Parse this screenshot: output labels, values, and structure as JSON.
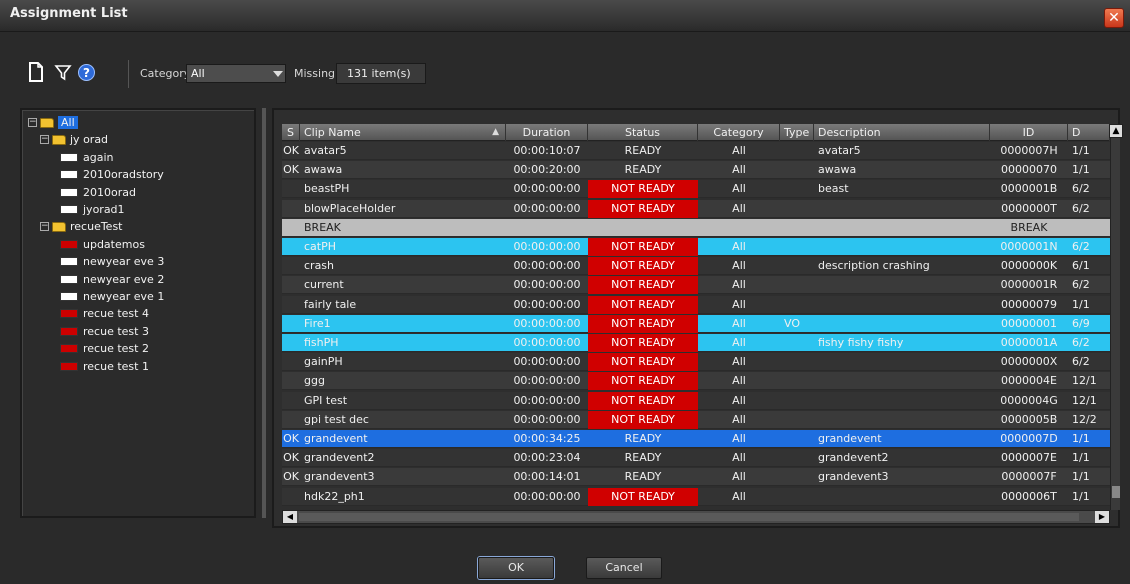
{
  "window": {
    "title": "Assignment List",
    "close_glyph": "✕"
  },
  "toolbar": {
    "category_label": "Category:",
    "category_value": "All",
    "missing_label": "Missing:",
    "missing_value": "131 item(s)",
    "help_glyph": "?"
  },
  "tree": [
    {
      "label": "All",
      "kind": "folder",
      "level": 0,
      "expander": "−",
      "selected": true
    },
    {
      "label": "jy orad",
      "kind": "folder",
      "level": 1,
      "expander": "−"
    },
    {
      "label": "again",
      "kind": "white",
      "level": 2
    },
    {
      "label": "2010oradstory",
      "kind": "white",
      "level": 2
    },
    {
      "label": "2010orad",
      "kind": "white",
      "level": 2
    },
    {
      "label": "jyorad1",
      "kind": "white",
      "level": 2
    },
    {
      "label": "recueTest",
      "kind": "folder",
      "level": 1,
      "expander": "−"
    },
    {
      "label": "updatemos",
      "kind": "red",
      "level": 2
    },
    {
      "label": "newyear eve 3",
      "kind": "white",
      "level": 2
    },
    {
      "label": "newyear eve 2",
      "kind": "white",
      "level": 2
    },
    {
      "label": "newyear eve 1",
      "kind": "white",
      "level": 2
    },
    {
      "label": "recue test 4",
      "kind": "red",
      "level": 2
    },
    {
      "label": "recue test 3",
      "kind": "red",
      "level": 2
    },
    {
      "label": "recue test 2",
      "kind": "red",
      "level": 2
    },
    {
      "label": "recue test 1",
      "kind": "red",
      "level": 2
    }
  ],
  "grid": {
    "columns": [
      "S",
      "Clip Name",
      "Duration",
      "Status",
      "Category",
      "Type",
      "Description",
      "ID",
      "D"
    ],
    "sort_glyph": "▲",
    "rows": [
      {
        "s": "OK",
        "clip": "avatar5",
        "duration": "00:00:10:07",
        "status": "READY",
        "category": "All",
        "type": "",
        "description": "avatar5",
        "id": "0000007H",
        "date": "1/1",
        "style": ""
      },
      {
        "s": "OK",
        "clip": "awawa",
        "duration": "00:00:20:00",
        "status": "READY",
        "category": "All",
        "type": "",
        "description": "awawa",
        "id": "00000070",
        "date": "1/1",
        "style": "alt"
      },
      {
        "s": "",
        "clip": "beastPH",
        "duration": "00:00:00:00",
        "status": "NOT READY",
        "category": "All",
        "type": "",
        "description": "beast",
        "id": "0000001B",
        "date": "6/2",
        "style": ""
      },
      {
        "s": "",
        "clip": "blowPlaceHolder",
        "duration": "00:00:00:00",
        "status": "NOT READY",
        "category": "All",
        "type": "",
        "description": "",
        "id": "0000000T",
        "date": "6/2",
        "style": "alt"
      },
      {
        "s": "",
        "clip": "BREAK",
        "duration": "",
        "status": "",
        "category": "",
        "type": "",
        "description": "",
        "id": "BREAK",
        "date": "",
        "style": "brk"
      },
      {
        "s": "",
        "clip": "catPH",
        "duration": "00:00:00:00",
        "status": "NOT READY",
        "category": "All",
        "type": "",
        "description": "",
        "id": "0000001N",
        "date": "6/2",
        "style": "cyan"
      },
      {
        "s": "",
        "clip": "crash",
        "duration": "00:00:00:00",
        "status": "NOT READY",
        "category": "All",
        "type": "",
        "description": "description crashing",
        "id": "0000000K",
        "date": "6/1",
        "style": ""
      },
      {
        "s": "",
        "clip": "current",
        "duration": "00:00:00:00",
        "status": "NOT READY",
        "category": "All",
        "type": "",
        "description": "",
        "id": "0000001R",
        "date": "6/2",
        "style": "alt"
      },
      {
        "s": "",
        "clip": "fairly tale",
        "duration": "00:00:00:00",
        "status": "NOT READY",
        "category": "All",
        "type": "",
        "description": "",
        "id": "00000079",
        "date": "1/1",
        "style": ""
      },
      {
        "s": "",
        "clip": "Fire1",
        "duration": "00:00:00:00",
        "status": "NOT READY",
        "category": "All",
        "type": "VO",
        "description": "",
        "id": "00000001",
        "date": "6/9",
        "style": "cyan"
      },
      {
        "s": "",
        "clip": "fishPH",
        "duration": "00:00:00:00",
        "status": "NOT READY",
        "category": "All",
        "type": "",
        "description": "fishy fishy fishy",
        "id": "0000001A",
        "date": "6/2",
        "style": "cyan"
      },
      {
        "s": "",
        "clip": "gainPH",
        "duration": "00:00:00:00",
        "status": "NOT READY",
        "category": "All",
        "type": "",
        "description": "",
        "id": "0000000X",
        "date": "6/2",
        "style": ""
      },
      {
        "s": "",
        "clip": "ggg",
        "duration": "00:00:00:00",
        "status": "NOT READY",
        "category": "All",
        "type": "",
        "description": "",
        "id": "0000004E",
        "date": "12/1",
        "style": "alt"
      },
      {
        "s": "",
        "clip": "GPI test",
        "duration": "00:00:00:00",
        "status": "NOT READY",
        "category": "All",
        "type": "",
        "description": "",
        "id": "0000004G",
        "date": "12/1",
        "style": ""
      },
      {
        "s": "",
        "clip": "gpi test dec",
        "duration": "00:00:00:00",
        "status": "NOT READY",
        "category": "All",
        "type": "",
        "description": "",
        "id": "0000005B",
        "date": "12/2",
        "style": "alt"
      },
      {
        "s": "OK",
        "clip": "grandevent",
        "duration": "00:00:34:25",
        "status": "READY",
        "category": "All",
        "type": "",
        "description": "grandevent",
        "id": "0000007D",
        "date": "1/1",
        "style": "blue"
      },
      {
        "s": "OK",
        "clip": "grandevent2",
        "duration": "00:00:23:04",
        "status": "READY",
        "category": "All",
        "type": "",
        "description": "grandevent2",
        "id": "0000007E",
        "date": "1/1",
        "style": ""
      },
      {
        "s": "OK",
        "clip": "grandevent3",
        "duration": "00:00:14:01",
        "status": "READY",
        "category": "All",
        "type": "",
        "description": "grandevent3",
        "id": "0000007F",
        "date": "1/1",
        "style": "alt"
      },
      {
        "s": "",
        "clip": "hdk22_ph1",
        "duration": "00:00:00:00",
        "status": "NOT READY",
        "category": "All",
        "type": "",
        "description": "",
        "id": "0000006T",
        "date": "1/1",
        "style": ""
      }
    ]
  },
  "footer": {
    "ok_label": "OK",
    "cancel_label": "Cancel"
  },
  "colors": {
    "not_ready": "#d00000",
    "selected": "#1e6ee0",
    "highlight": "#2cc4f0",
    "folder": "#f2c230"
  }
}
